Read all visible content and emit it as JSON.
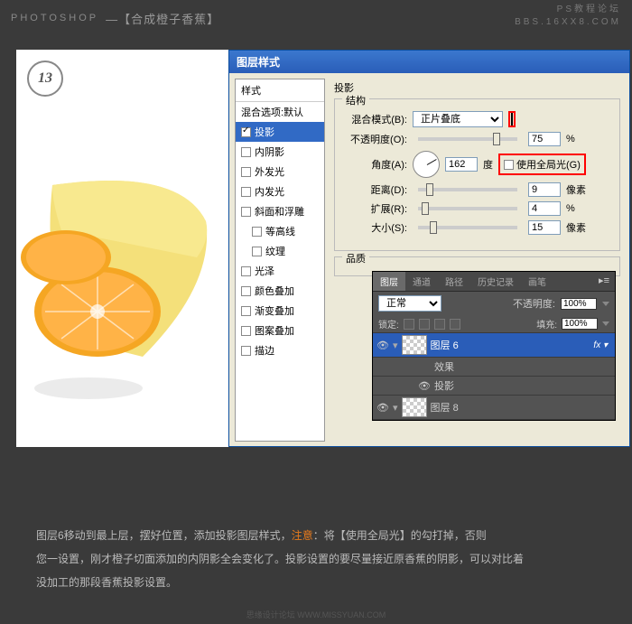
{
  "header": {
    "app": "PHOTOSHOP",
    "title": "—【合成橙子香蕉】",
    "forum": "PS教程论坛",
    "url": "BBS.16XX8.COM"
  },
  "step": "13",
  "dialog": {
    "title": "图层样式",
    "list_header": "样式",
    "blend_defaults": "混合选项:默认",
    "items": [
      {
        "label": "投影",
        "checked": true,
        "selected": true
      },
      {
        "label": "内阴影",
        "checked": false
      },
      {
        "label": "外发光",
        "checked": false
      },
      {
        "label": "内发光",
        "checked": false
      },
      {
        "label": "斜面和浮雕",
        "checked": false
      },
      {
        "label": "等高线",
        "checked": false,
        "indent": true
      },
      {
        "label": "纹理",
        "checked": false,
        "indent": true
      },
      {
        "label": "光泽",
        "checked": false
      },
      {
        "label": "颜色叠加",
        "checked": false
      },
      {
        "label": "渐变叠加",
        "checked": false
      },
      {
        "label": "图案叠加",
        "checked": false
      },
      {
        "label": "描边",
        "checked": false
      }
    ],
    "section": "投影",
    "structure": "结构",
    "blend_mode_label": "混合模式(B):",
    "blend_mode_value": "正片叠底",
    "opacity_label": "不透明度(O):",
    "opacity_value": "75",
    "pct": "%",
    "angle_label": "角度(A):",
    "angle_value": "162",
    "degree": "度",
    "global_light": "使用全局光(G)",
    "distance_label": "距离(D):",
    "distance_value": "9",
    "px": "像素",
    "spread_label": "扩展(R):",
    "spread_value": "4",
    "size_label": "大小(S):",
    "size_value": "15",
    "quality": "品质"
  },
  "layers": {
    "tabs": [
      "图层",
      "通道",
      "路径",
      "历史记录",
      "画笔"
    ],
    "mode": "正常",
    "opacity_label": "不透明度:",
    "opacity": "100%",
    "lock_label": "锁定:",
    "fill_label": "填充:",
    "fill": "100%",
    "rows": [
      {
        "name": "图层 6",
        "selected": true,
        "fx": true
      },
      {
        "name": "效果",
        "sub": true
      },
      {
        "name": "投影",
        "sub": true,
        "eye": true
      },
      {
        "name": "图层 8"
      }
    ]
  },
  "footer": {
    "l1a": "图层6移动到最上层，摆好位置，添加投影图层样式，",
    "l1b": "注意",
    "l1c": "：将【使用全局光】的勾打掉，否则",
    "l2": "您一设置，刚才橙子切面添加的内阴影全会变化了。投影设置的要尽量接近原香蕉的阴影，可以对比着",
    "l3": "没加工的那段香蕉投影设置。"
  },
  "watermark": "思缘设计论坛   WWW.MISSYUAN.COM"
}
